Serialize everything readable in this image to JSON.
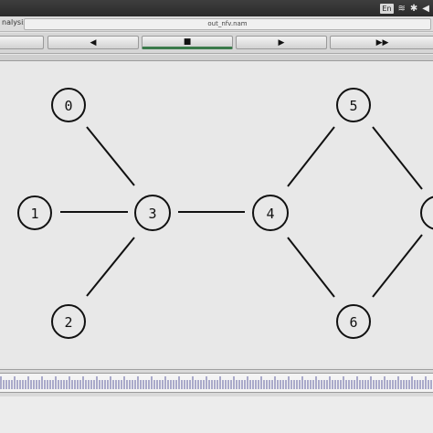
{
  "system_bar": {
    "keyboard_indicator": "En"
  },
  "title_row": {
    "app_label": "nalysis",
    "file_name": "out_nfv.nam"
  },
  "controls": [
    {
      "name": "rewind-button",
      "glyph": "",
      "active": false
    },
    {
      "name": "step-back-button",
      "glyph": "◀",
      "active": false
    },
    {
      "name": "stop-button",
      "glyph": "■",
      "active": true
    },
    {
      "name": "play-button",
      "glyph": "▶",
      "active": false
    },
    {
      "name": "fast-forward-button",
      "glyph": "▶▶",
      "active": false
    }
  ],
  "graph": {
    "nodes": [
      {
        "id": "0",
        "label": "0"
      },
      {
        "id": "1",
        "label": "1"
      },
      {
        "id": "2",
        "label": "2"
      },
      {
        "id": "3",
        "label": "3"
      },
      {
        "id": "4",
        "label": "4"
      },
      {
        "id": "5",
        "label": "5"
      },
      {
        "id": "6",
        "label": "6"
      },
      {
        "id": "7",
        "label": ""
      }
    ],
    "edges": [
      [
        "0",
        "3"
      ],
      [
        "1",
        "3"
      ],
      [
        "2",
        "3"
      ],
      [
        "3",
        "4"
      ],
      [
        "4",
        "5"
      ],
      [
        "4",
        "6"
      ],
      [
        "5",
        "7"
      ],
      [
        "6",
        "7"
      ]
    ]
  },
  "colors": {
    "active_indicator": "#3a7a4a",
    "tick_mark": "#3a3a8a"
  }
}
